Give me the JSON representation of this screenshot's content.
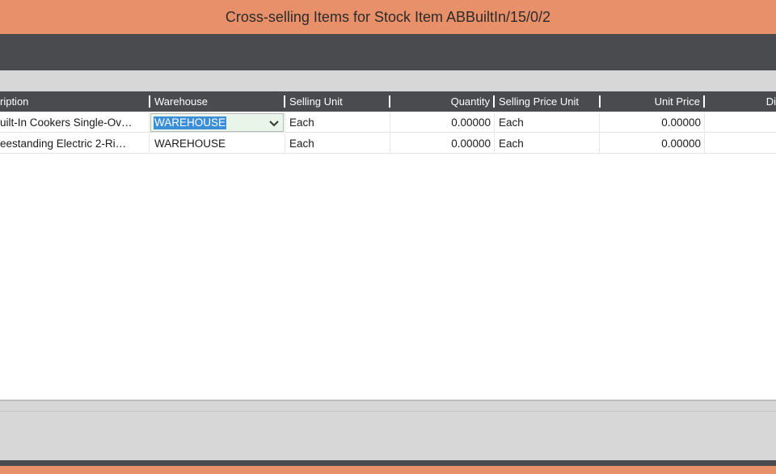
{
  "window": {
    "title": "Cross-selling Items for Stock Item ABBuiltIn/15/0/2"
  },
  "grid": {
    "columns": [
      {
        "key": "description",
        "label": "ription"
      },
      {
        "key": "warehouse",
        "label": "Warehouse"
      },
      {
        "key": "selling_unit",
        "label": "Selling Unit"
      },
      {
        "key": "quantity",
        "label": "Quantity"
      },
      {
        "key": "selling_price_unit",
        "label": "Selling Price Unit"
      },
      {
        "key": "unit_price",
        "label": "Unit Price"
      },
      {
        "key": "discount",
        "label": "Di"
      }
    ],
    "rows": [
      {
        "description": "uilt-In Cookers Single-Ov…",
        "warehouse": "WAREHOUSE",
        "selling_unit": "Each",
        "quantity": "0.00000",
        "selling_price_unit": "Each",
        "unit_price": "0.00000"
      },
      {
        "description": "eestanding Electric 2-Ri…",
        "warehouse": "WAREHOUSE",
        "selling_unit": "Each",
        "quantity": "0.00000",
        "selling_price_unit": "Each",
        "unit_price": "0.00000"
      }
    ],
    "editor": {
      "column": "warehouse",
      "row": 0,
      "icon": "chevron-down-icon"
    }
  },
  "colors": {
    "title_bar": "#e8906a",
    "dark_bar": "#4a4b4f",
    "panel": "#d7d7d7",
    "selection": "#3b8fd9",
    "editor_bg": "#eaf5ea"
  }
}
